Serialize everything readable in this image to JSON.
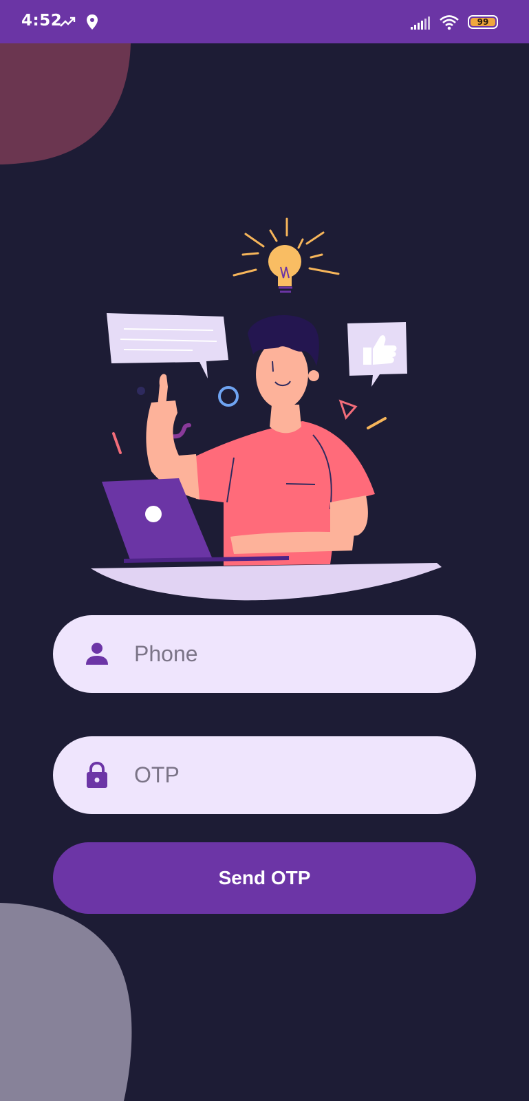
{
  "status_bar": {
    "time": "4:52",
    "battery_level": "99",
    "icons": [
      "trend-up-icon",
      "location-pin-icon",
      "signal-icon",
      "wifi-icon",
      "battery-icon"
    ],
    "background_color": "#6b35a5"
  },
  "form": {
    "phone": {
      "placeholder": "Phone",
      "value": "",
      "icon": "person-icon"
    },
    "otp": {
      "placeholder": "OTP",
      "value": "",
      "icon": "lock-icon"
    },
    "send_button_label": "Send OTP"
  },
  "colors": {
    "background": "#1d1c35",
    "field_background": "#efe5fd",
    "accent": "#6c35a6",
    "blob_top": "#6b3650",
    "blob_bottom": "#878299"
  }
}
